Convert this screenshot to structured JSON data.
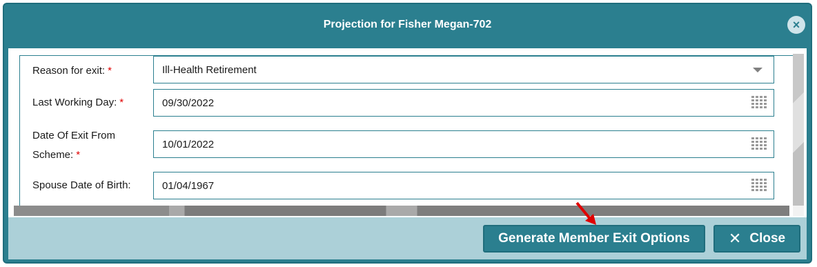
{
  "dialog": {
    "title": "Projection for Fisher Megan-702",
    "close_icon": "×"
  },
  "form": {
    "reason_for_exit": {
      "label": "Reason for exit:",
      "required": "*",
      "value": "Ill-Health Retirement"
    },
    "last_working_day": {
      "label": "Last Working Day:",
      "required": "*",
      "value": "09/30/2022"
    },
    "date_of_exit": {
      "label_line1": "Date Of Exit From",
      "label_line2": "Scheme:",
      "required": "*",
      "value": "10/01/2022"
    },
    "spouse_dob": {
      "label": "Spouse Date of Birth:",
      "value": "01/04/1967"
    }
  },
  "footer": {
    "generate_label": "Generate Member Exit Options",
    "close_label": "Close",
    "close_glyph": "✕"
  },
  "colors": {
    "primary": "#2b7f8f",
    "footer_bg": "#acd0d8",
    "required": "#e00000",
    "annotation_arrow": "#e00000"
  }
}
